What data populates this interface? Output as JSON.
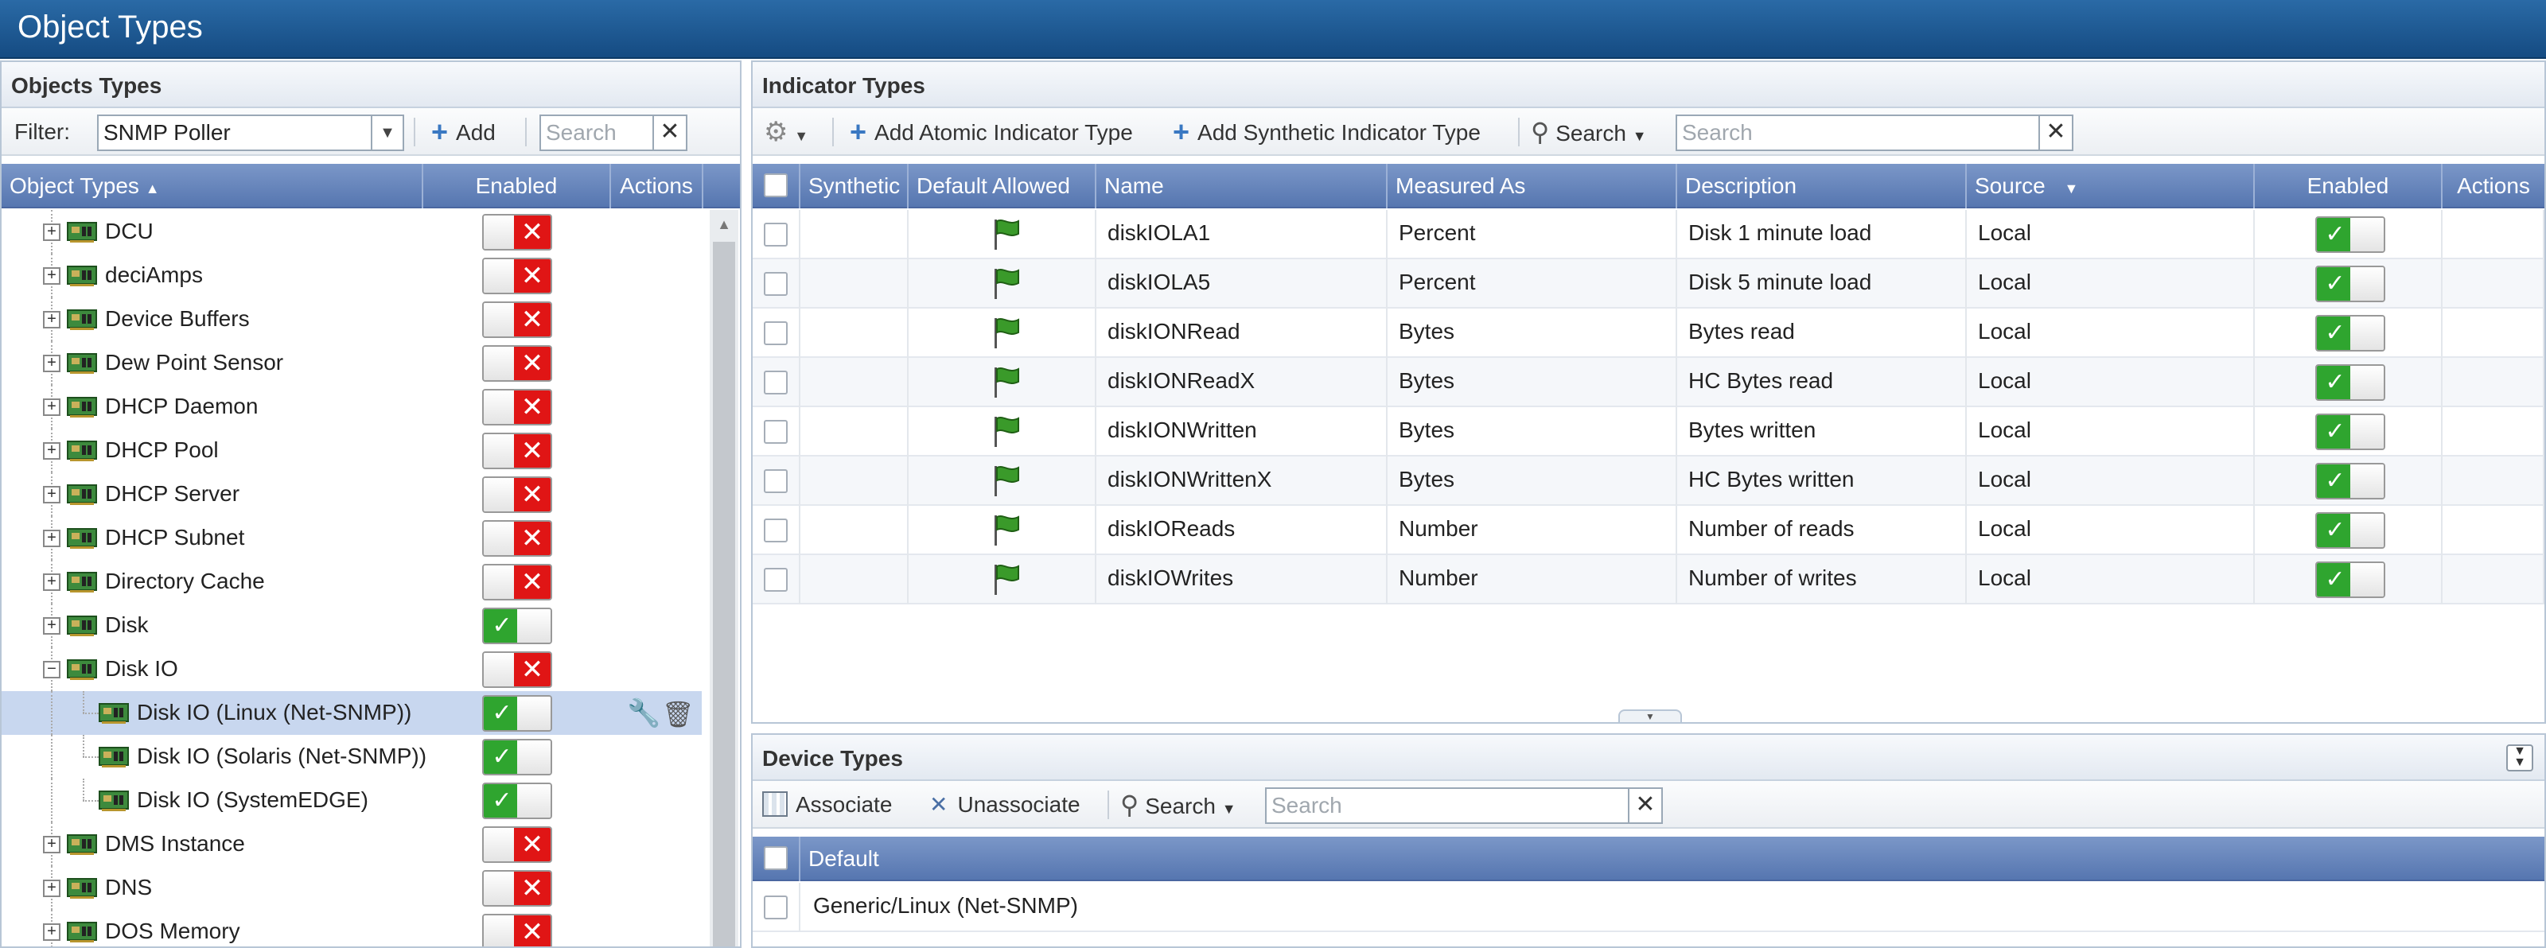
{
  "window": {
    "title": "Object Types"
  },
  "left_panel": {
    "title": "Objects Types",
    "filter_label": "Filter:",
    "filter_value": "SNMP Poller",
    "add_label": "Add",
    "search_placeholder": "Search",
    "columns": {
      "object_types": "Object Types",
      "enabled": "Enabled",
      "actions": "Actions"
    },
    "items": [
      {
        "label": "DCU",
        "enabled": false,
        "expander": "+"
      },
      {
        "label": "deciAmps",
        "enabled": false,
        "expander": "+"
      },
      {
        "label": "Device Buffers",
        "enabled": false,
        "expander": "+"
      },
      {
        "label": "Dew Point Sensor",
        "enabled": false,
        "expander": "+"
      },
      {
        "label": "DHCP Daemon",
        "enabled": false,
        "expander": "+"
      },
      {
        "label": "DHCP Pool",
        "enabled": false,
        "expander": "+"
      },
      {
        "label": "DHCP Server",
        "enabled": false,
        "expander": "+"
      },
      {
        "label": "DHCP Subnet",
        "enabled": false,
        "expander": "+"
      },
      {
        "label": "Directory Cache",
        "enabled": false,
        "expander": "+"
      },
      {
        "label": "Disk",
        "enabled": true,
        "expander": "+"
      },
      {
        "label": "Disk IO",
        "enabled": false,
        "expander": "−"
      },
      {
        "label": "Disk IO (Linux (Net-SNMP))",
        "enabled": true,
        "expander": "",
        "child": true,
        "selected": true
      },
      {
        "label": "Disk IO (Solaris (Net-SNMP))",
        "enabled": true,
        "expander": "",
        "child": true
      },
      {
        "label": "Disk IO (SystemEDGE)",
        "enabled": true,
        "expander": "",
        "child": true
      },
      {
        "label": "DMS Instance",
        "enabled": false,
        "expander": "+"
      },
      {
        "label": "DNS",
        "enabled": false,
        "expander": "+"
      },
      {
        "label": "DOS Memory",
        "enabled": false,
        "expander": "+"
      }
    ]
  },
  "indicator_panel": {
    "title": "Indicator Types",
    "add_atomic_label": "Add Atomic Indicator Type",
    "add_synthetic_label": "Add Synthetic Indicator Type",
    "search_label": "Search",
    "search_placeholder": "Search",
    "columns": {
      "synthetic": "Synthetic",
      "default_allowed": "Default Allowed",
      "name": "Name",
      "measured_as": "Measured As",
      "description": "Description",
      "source": "Source",
      "enabled": "Enabled",
      "actions": "Actions"
    },
    "rows": [
      {
        "name": "diskIOLA1",
        "measured_as": "Percent",
        "description": "Disk 1 minute load",
        "source": "Local",
        "enabled": true
      },
      {
        "name": "diskIOLA5",
        "measured_as": "Percent",
        "description": "Disk 5 minute load",
        "source": "Local",
        "enabled": true
      },
      {
        "name": "diskIONRead",
        "measured_as": "Bytes",
        "description": "Bytes read",
        "source": "Local",
        "enabled": true
      },
      {
        "name": "diskIONReadX",
        "measured_as": "Bytes",
        "description": "HC Bytes read",
        "source": "Local",
        "enabled": true
      },
      {
        "name": "diskIONWritten",
        "measured_as": "Bytes",
        "description": "Bytes written",
        "source": "Local",
        "enabled": true
      },
      {
        "name": "diskIONWrittenX",
        "measured_as": "Bytes",
        "description": "HC Bytes written",
        "source": "Local",
        "enabled": true
      },
      {
        "name": "diskIOReads",
        "measured_as": "Number",
        "description": "Number of reads",
        "source": "Local",
        "enabled": true
      },
      {
        "name": "diskIOWrites",
        "measured_as": "Number",
        "description": "Number of writes",
        "source": "Local",
        "enabled": true
      }
    ]
  },
  "device_panel": {
    "title": "Device Types",
    "associate_label": "Associate",
    "unassociate_label": "Unassociate",
    "search_label": "Search",
    "search_placeholder": "Search",
    "column_default": "Default",
    "rows": [
      {
        "label": "Generic/Linux (Net-SNMP)"
      }
    ]
  },
  "colors": {
    "header_blue": "#1c5590",
    "grid_header": "#6585bd",
    "toggle_on": "#2fa52f",
    "toggle_off": "#e01515",
    "selected_row": "#c8d7ef"
  }
}
